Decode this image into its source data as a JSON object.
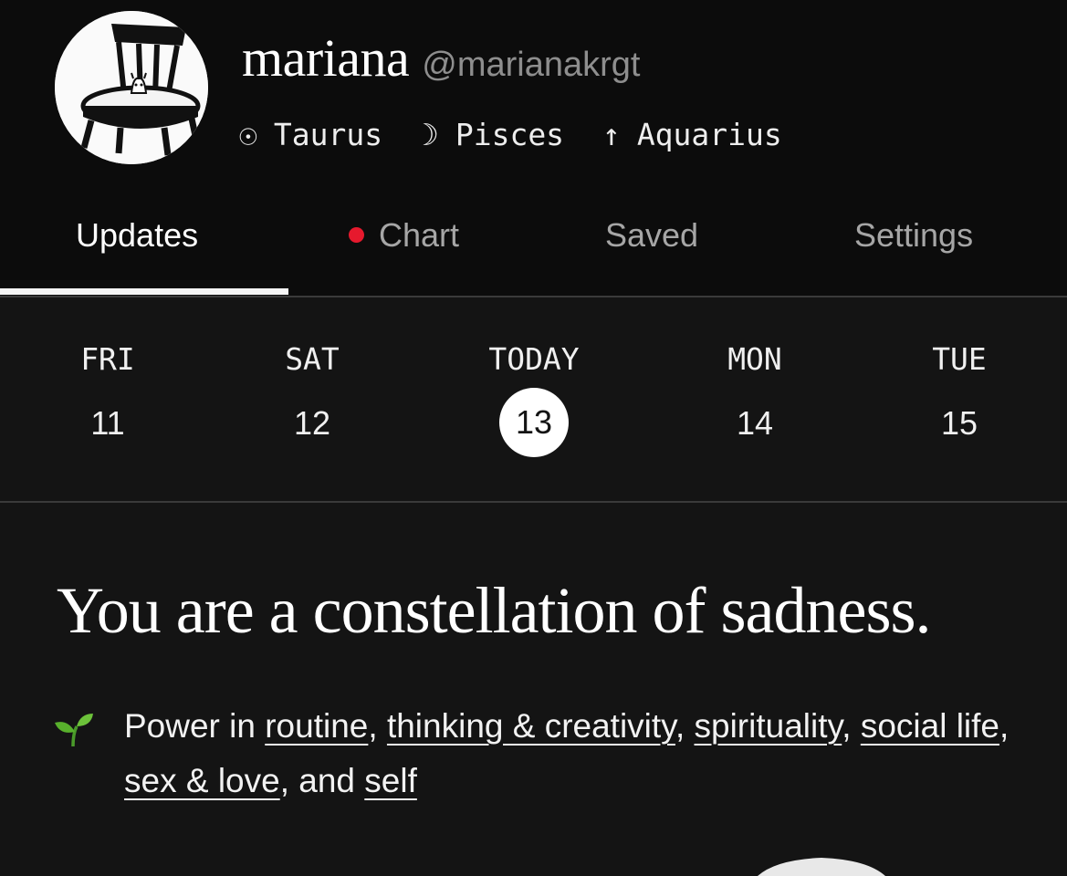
{
  "profile": {
    "display_name": "mariana",
    "handle": "@marianakrgt",
    "signs": [
      {
        "icon": "sun-icon",
        "glyph": "☉",
        "name": "Taurus"
      },
      {
        "icon": "moon-icon",
        "glyph": "☽",
        "name": "Pisces"
      },
      {
        "icon": "rising-icon",
        "glyph": "↑",
        "name": "Aquarius"
      }
    ]
  },
  "tabs": [
    {
      "label": "Updates",
      "active": true
    },
    {
      "label": "Chart",
      "has_notification": true,
      "notification_color": "#e6192d"
    },
    {
      "label": "Saved"
    },
    {
      "label": "Settings"
    }
  ],
  "days": [
    {
      "label": "FRI",
      "number": "11"
    },
    {
      "label": "SAT",
      "number": "12"
    },
    {
      "label": "TODAY",
      "number": "13",
      "selected": true
    },
    {
      "label": "MON",
      "number": "14"
    },
    {
      "label": "TUE",
      "number": "15"
    }
  ],
  "update": {
    "headline": "You are a constellation of sadness.",
    "power_icon": "seedling-icon",
    "power_prefix": "Power in",
    "power_topics": [
      "routine",
      "thinking & creativity",
      "spirituality",
      "social life",
      "sex & love",
      "self"
    ],
    "connector_and": "and"
  },
  "colors": {
    "background": "#141414",
    "header_background": "#0c0c0c",
    "text": "#f2f2f2",
    "muted": "#a6a6a6",
    "accent_red": "#e6192d"
  }
}
